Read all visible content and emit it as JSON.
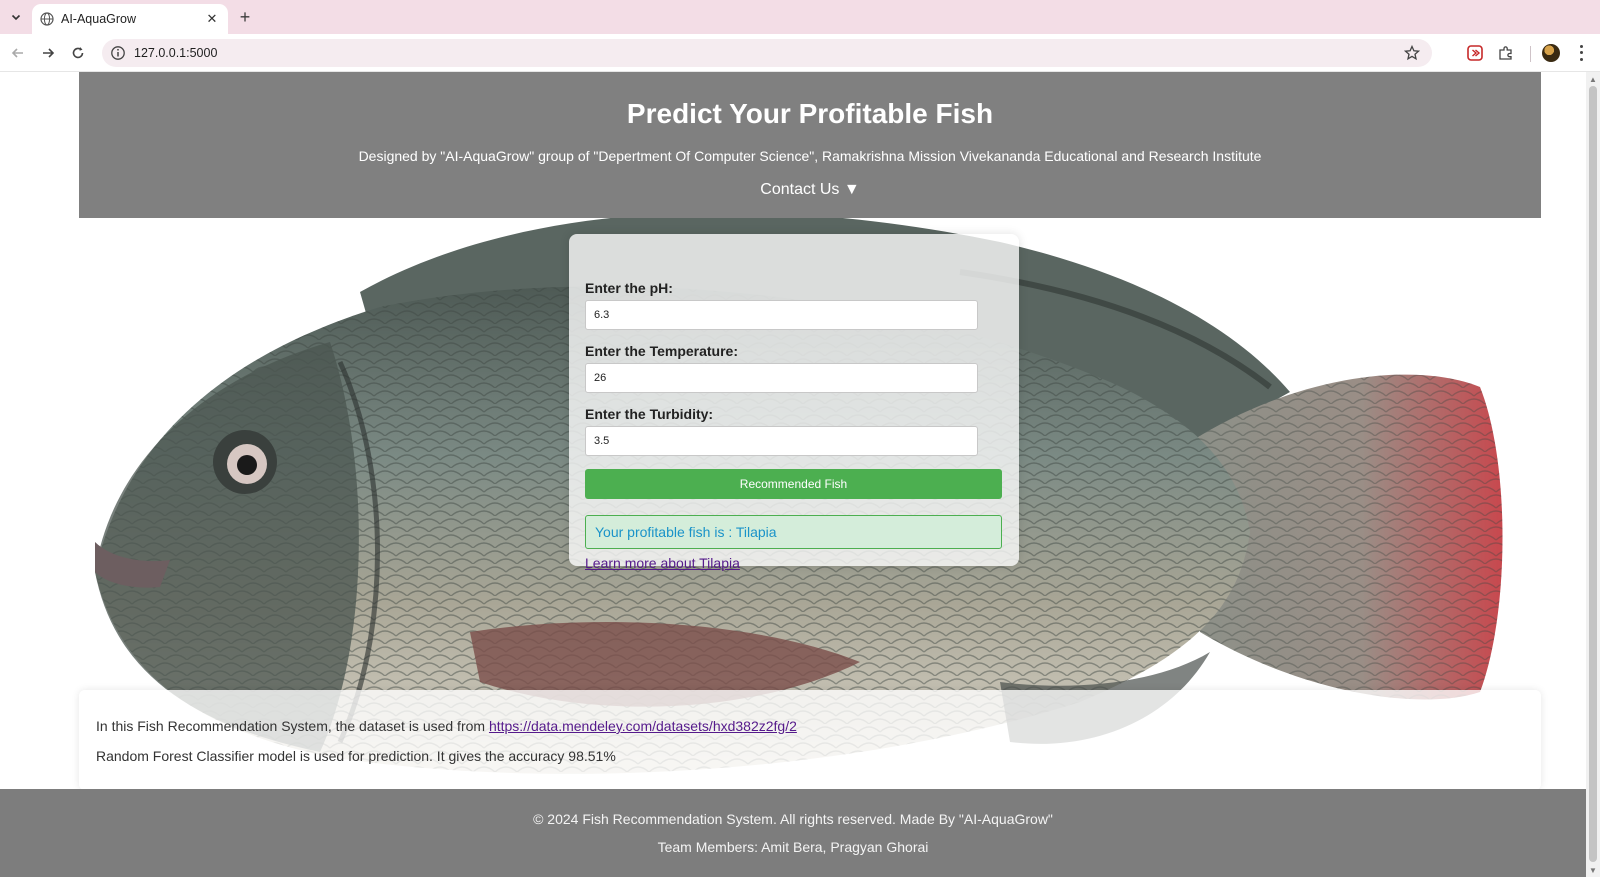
{
  "browser": {
    "tab_title": "AI-AquaGrow",
    "url": "127.0.0.1:5000"
  },
  "header": {
    "title": "Predict Your Profitable Fish",
    "designer": "Designed by \"AI-AquaGrow\" group of \"Depertment Of Computer Science\", Ramakrishna Mission Vivekananda Educational and Research Institute",
    "contact": "Contact Us ▼"
  },
  "form": {
    "ph_label": "Enter the pH:",
    "ph_value": "6.3",
    "temperature_label": "Enter the Temperature:",
    "temperature_value": "26",
    "turbidity_label": "Enter the Turbidity:",
    "turbidity_value": "3.5",
    "submit_label": "Recommended Fish",
    "result_text": "Your profitable fish is : Tilapia",
    "learn_more": "Learn more about Tilapia"
  },
  "info": {
    "dataset_prefix": "In this Fish Recommendation System, the dataset is used from ",
    "dataset_link": "https://data.mendeley.com/datasets/hxd382z2fg/2",
    "model_text": "Random Forest Classifier model is used for prediction. It gives the accuracy 98.51%"
  },
  "footer": {
    "copyright": "© 2024 Fish Recommendation System. All rights reserved. Made By \"AI-AquaGrow\"",
    "team": "Team Members: Amit Bera, Pragyan Ghorai"
  },
  "icons": {
    "tab_menu": "chevron-down-icon",
    "tab_favicon": "globe-icon",
    "tab_close": "close-icon",
    "new_tab": "plus-icon",
    "back": "arrow-left-icon",
    "forward": "arrow-right-icon",
    "reload": "reload-icon",
    "site_info": "info-icon",
    "bookmark": "star-icon",
    "extension_red": "extension-icon",
    "extensions": "puzzle-icon",
    "menu": "kebab-menu-icon"
  },
  "colors": {
    "header_bg": "#808080",
    "button_bg": "#4caf50",
    "result_bg": "#d4edda",
    "result_text": "#1a93c9",
    "link": "#551a8b",
    "tabbar_bg": "#f3dde6"
  }
}
